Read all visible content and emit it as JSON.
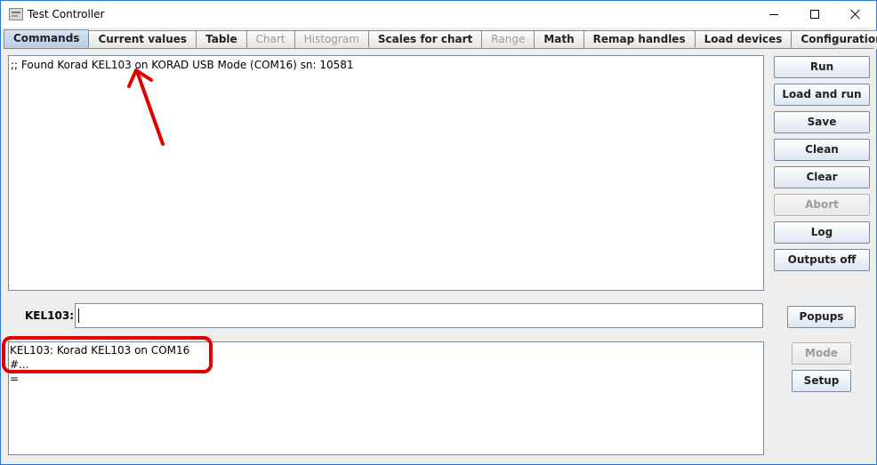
{
  "window": {
    "title": "Test Controller"
  },
  "tabs": [
    {
      "label": "Commands",
      "state": "active"
    },
    {
      "label": "Current values",
      "state": "enabled"
    },
    {
      "label": "Table",
      "state": "enabled"
    },
    {
      "label": "Chart",
      "state": "disabled"
    },
    {
      "label": "Histogram",
      "state": "disabled"
    },
    {
      "label": "Scales for chart",
      "state": "enabled"
    },
    {
      "label": "Range",
      "state": "disabled"
    },
    {
      "label": "Math",
      "state": "enabled"
    },
    {
      "label": "Remap handles",
      "state": "enabled"
    },
    {
      "label": "Load devices",
      "state": "enabled"
    },
    {
      "label": "Configuration",
      "state": "enabled"
    }
  ],
  "main_log": {
    "lines": [
      ";; Found Korad KEL103 on KORAD USB Mode (COM16) sn: 10581"
    ]
  },
  "side_buttons": {
    "run": "Run",
    "load_and_run": "Load and run",
    "save": "Save",
    "clean": "Clean",
    "clear": "Clear",
    "abort": "Abort",
    "log": "Log",
    "outputs_off": "Outputs off"
  },
  "command": {
    "device_label": "KEL103:",
    "value": ""
  },
  "lower_buttons": {
    "popups": "Popups",
    "mode": "Mode",
    "setup": "Setup"
  },
  "output": {
    "lines": [
      "KEL103: Korad KEL103 on COM16",
      "#...",
      "="
    ]
  },
  "colors": {
    "annotation": "#e00000",
    "active_tab": "#b8cde6",
    "disabled_text": "#9b9b9b"
  }
}
